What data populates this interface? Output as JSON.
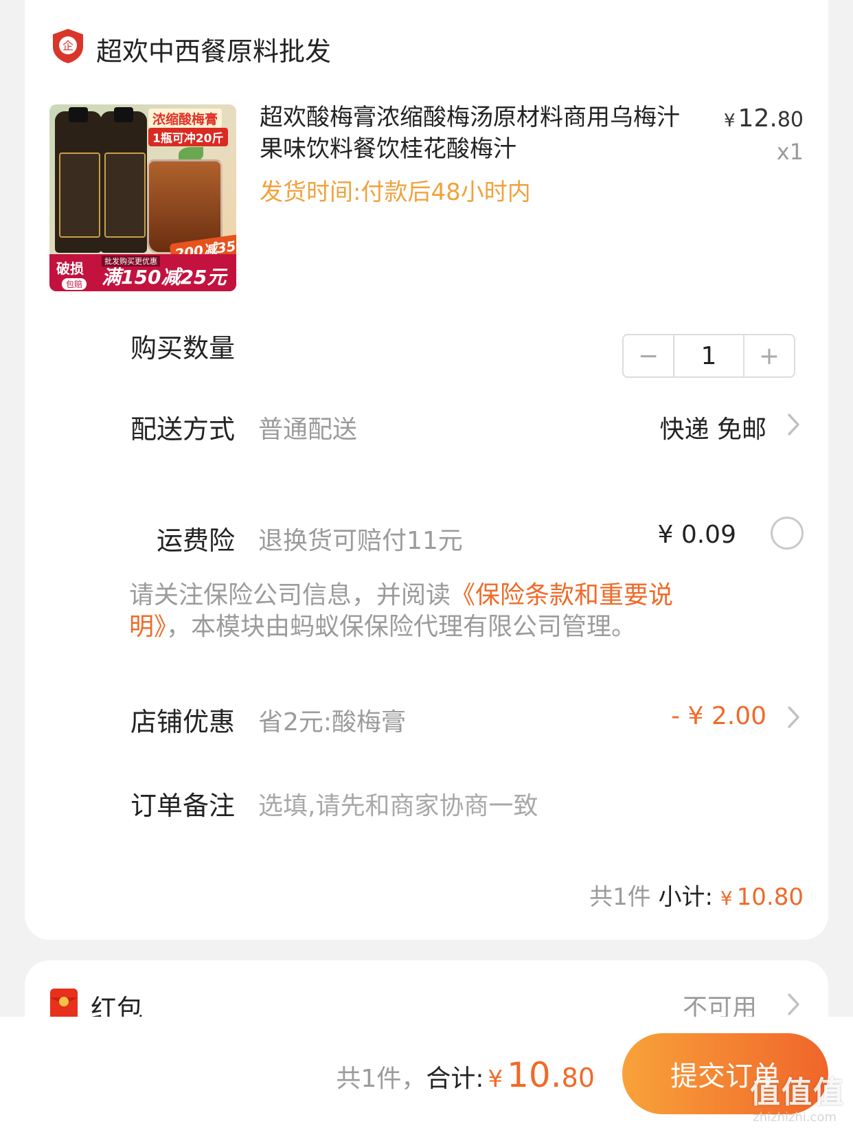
{
  "shop": {
    "icon": "enterprise-shield-icon",
    "icon_glyph": "企",
    "name": "超欢中西餐原料批发"
  },
  "product": {
    "thumbnail": {
      "tag_top": "浓缩酸梅膏",
      "tag_sub": "1瓶可冲20斤",
      "tag_discount": "200减35",
      "badge_broken": "破损",
      "badge_compensate": "包赔",
      "badge_wholesale": "批发购买更优惠",
      "promo": "满150减25元"
    },
    "title": "超欢酸梅膏浓缩酸梅汤原材料商用乌梅汁果味饮料餐饮桂花酸梅汁",
    "delivery_note": "发货时间:付款后48小时内",
    "price_yen": "¥",
    "price_int": "12.",
    "price_dec": "80",
    "quantity_badge": "x1"
  },
  "rows": {
    "quantity": {
      "label": "购买数量",
      "value": "1",
      "minus": "−",
      "plus": "+"
    },
    "delivery": {
      "label": "配送方式",
      "value": "普通配送",
      "right": "快递 免邮"
    },
    "shipping_insurance": {
      "label": "运费险",
      "value": "退换货可赔付11元",
      "right": "¥ 0.09"
    },
    "insurance_notice": {
      "pre": "请关注保险公司信息，并阅读",
      "link": "《保险条款和重要说明》",
      "post": "，本模块由蚂蚁保保险代理有限公司管理。"
    },
    "store_discount": {
      "label": "店铺优惠",
      "value": "省2元:酸梅膏",
      "right": "- ¥ 2.00"
    },
    "order_note": {
      "label": "订单备注",
      "placeholder": "选填,请先和商家协商一致"
    }
  },
  "subtotal": {
    "count": "共1件",
    "label": " 小计: ",
    "yen": "¥",
    "amount": "10.80"
  },
  "redpack": {
    "label": "红包",
    "status": "不可用"
  },
  "footer": {
    "count": "共1件，",
    "label": "合计:",
    "yen": "¥",
    "total_int": "10.",
    "total_dec": "80",
    "submit": "提交订单",
    "watermark": "值值值",
    "watermark_url": "zhizhizhi.com"
  },
  "colors": {
    "accent": "#f06a28",
    "delivery": "#f0a23d",
    "shop_icon": "#d9362b",
    "redpack": "#e8301c"
  }
}
